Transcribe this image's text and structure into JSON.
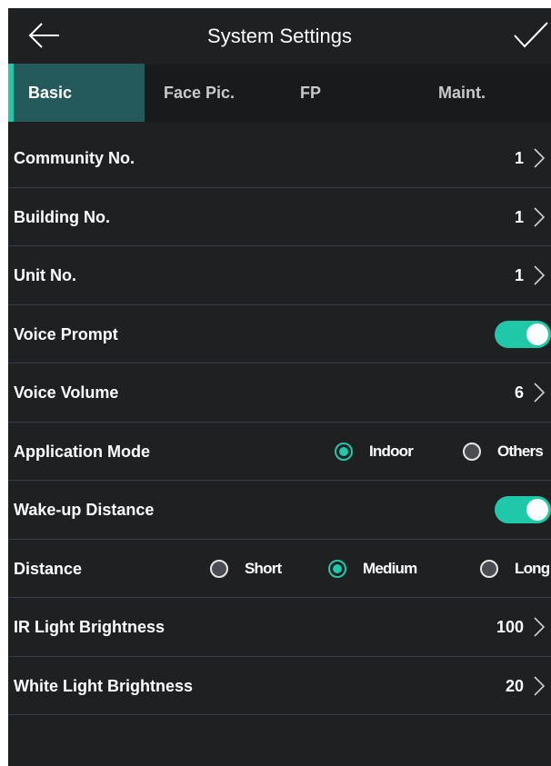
{
  "header": {
    "title": "System Settings",
    "back_icon": "arrow-left-icon",
    "confirm_icon": "check-icon"
  },
  "tabs": [
    {
      "label": "Basic",
      "active": true
    },
    {
      "label": "Face Pic.",
      "active": false
    },
    {
      "label": "FP",
      "active": false
    },
    {
      "label": "Maint.",
      "active": false
    }
  ],
  "settings": {
    "community_no": {
      "label": "Community No.",
      "value": "1"
    },
    "building_no": {
      "label": "Building No.",
      "value": "1"
    },
    "unit_no": {
      "label": "Unit No.",
      "value": "1"
    },
    "voice_prompt": {
      "label": "Voice Prompt",
      "enabled": true
    },
    "voice_volume": {
      "label": "Voice Volume",
      "value": "6"
    },
    "application_mode": {
      "label": "Application Mode",
      "options": [
        "Indoor",
        "Others"
      ],
      "selected": "Indoor"
    },
    "wake_up_distance": {
      "label": "Wake-up Distance",
      "enabled": true
    },
    "distance": {
      "label": "Distance",
      "options": [
        "Short",
        "Medium",
        "Long"
      ],
      "selected": "Medium"
    },
    "ir_light_brightness": {
      "label": "IR Light Brightness",
      "value": "100"
    },
    "white_light_brightness": {
      "label": "White Light Brightness",
      "value": "20"
    }
  },
  "colors": {
    "accent": "#20c9a9",
    "background": "#1e2022",
    "tab_bar": "#181a1c",
    "active_tab": "#245a5c"
  }
}
